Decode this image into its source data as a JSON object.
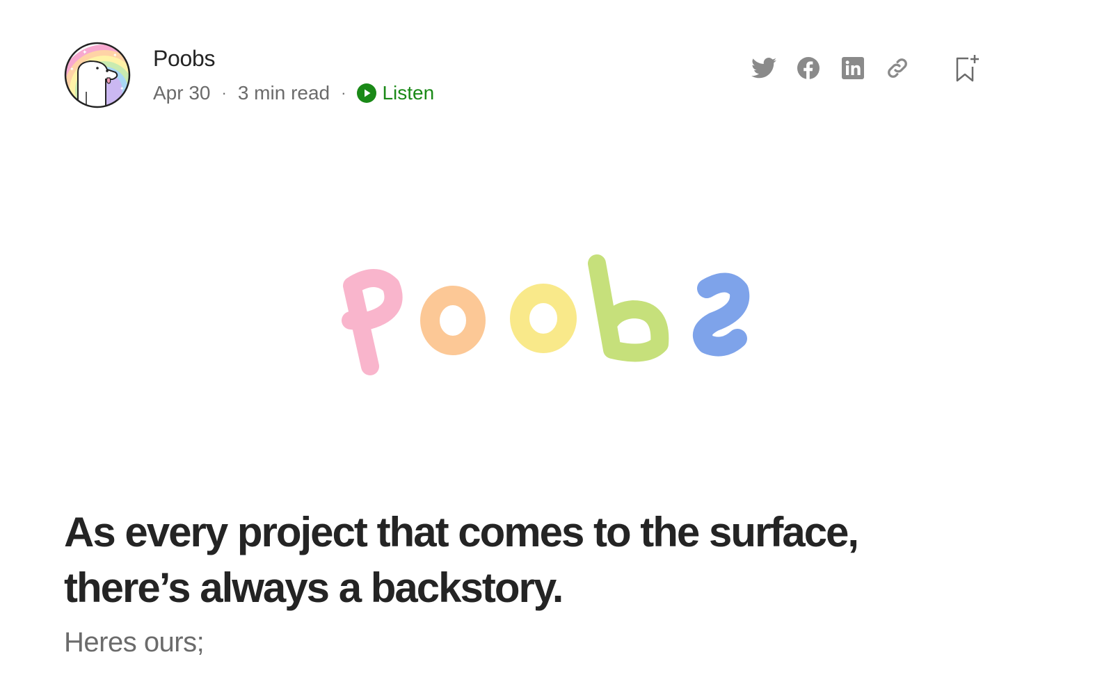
{
  "author": {
    "name": "Poobs",
    "avatar_icon": "rainbow-creature-avatar"
  },
  "meta": {
    "date": "Apr 30",
    "separator": "·",
    "read_time": "3 min read",
    "listen_label": "Listen",
    "listen_color": "#1a8917"
  },
  "actions": {
    "icons": [
      "twitter-icon",
      "facebook-icon",
      "linkedin-icon",
      "link-icon",
      "bookmark-add-icon"
    ],
    "icon_color": "#8a8a8a"
  },
  "hero": {
    "letters": [
      "p",
      "o",
      "o",
      "b",
      "s"
    ],
    "letter_colors": [
      "#f9b5cc",
      "#fcc896",
      "#f9e98a",
      "#c6e07b",
      "#7ea3ea"
    ]
  },
  "article": {
    "headline": "As every project that comes to the surface, there’s always a backstory.",
    "subtitle": "Heres ours;"
  }
}
